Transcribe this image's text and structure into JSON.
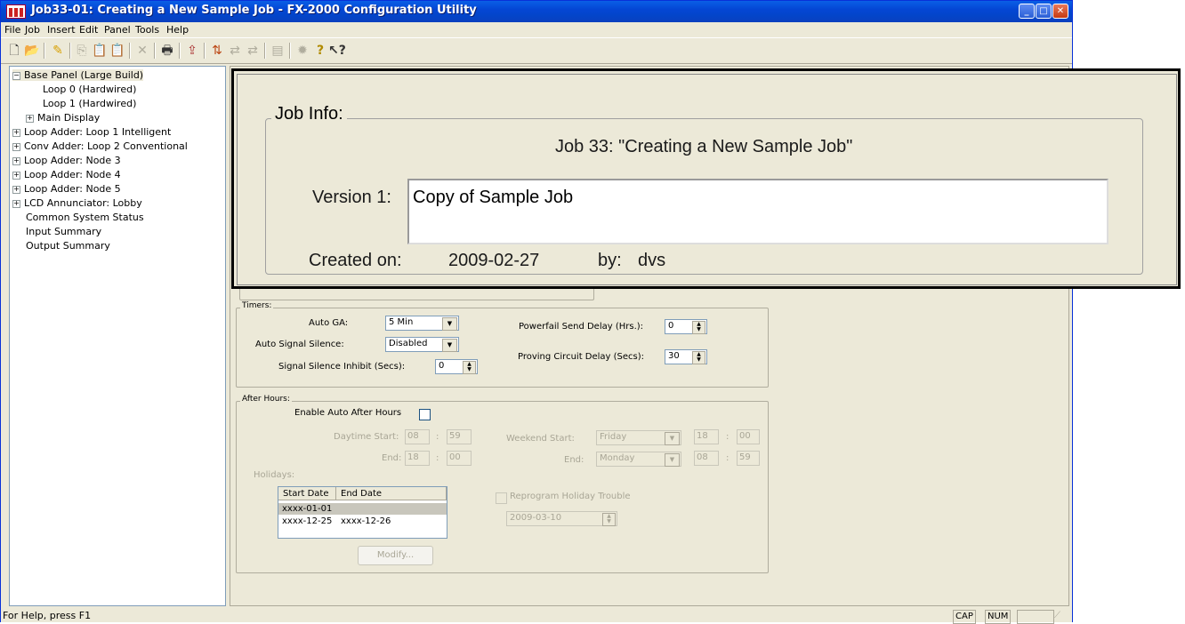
{
  "window": {
    "title": "Job33-01: Creating a New Sample Job - FX-2000 Configuration Utility"
  },
  "caption_buttons": {
    "minimize": "_",
    "maximize": "□",
    "close": "✕"
  },
  "menu": [
    "File",
    "Job",
    "Insert",
    "Edit",
    "Panel",
    "Tools",
    "Help"
  ],
  "toolbar_icons": [
    "new-icon",
    "open-icon",
    "edit-icon",
    "copy-icon",
    "paste-icon",
    "paste-special-icon",
    "delete-icon",
    "print-icon",
    "upload-icon",
    "download-icon",
    "compare-icon",
    "compare2-icon",
    "report-icon",
    "settings-icon",
    "help-icon",
    "context-help-icon"
  ],
  "tree": {
    "items": [
      {
        "label": "Base Panel (Large Build)",
        "exp": "−"
      },
      {
        "label": "Loop 0  (Hardwired)",
        "exp": ""
      },
      {
        "label": "Loop 1  (Hardwired)",
        "exp": ""
      },
      {
        "label": "Main Display",
        "exp": "+"
      },
      {
        "label": "Loop Adder: Loop 1 Intelligent",
        "exp": "+"
      },
      {
        "label": "Conv Adder: Loop 2 Conventional",
        "exp": "+"
      },
      {
        "label": "Loop Adder: Node 3",
        "exp": "+"
      },
      {
        "label": "Loop Adder: Node 4",
        "exp": "+"
      },
      {
        "label": "Loop Adder: Node 5",
        "exp": "+"
      },
      {
        "label": "LCD Annunciator: Lobby",
        "exp": "+"
      },
      {
        "label": "Common System Status",
        "exp": ""
      },
      {
        "label": "Input Summary",
        "exp": ""
      },
      {
        "label": "Output Summary",
        "exp": ""
      }
    ]
  },
  "job_info": {
    "legend": "Job Info:",
    "job_title": "Job 33:  \"Creating a New Sample Job\"",
    "version_label": "Version 1:",
    "version_text": "Copy of Sample Job",
    "created_label": "Created on:",
    "created_date": "2009-02-27",
    "by_label": "by:",
    "by_value": "dvs"
  },
  "timers": {
    "legend": "Timers:",
    "auto_ga_label": "Auto GA:",
    "auto_ga_value": "5 Min",
    "auto_signal_silence_label": "Auto Signal Silence:",
    "auto_signal_silence_value": "Disabled",
    "signal_silence_inhibit_label": "Signal Silence Inhibit (Secs):",
    "signal_silence_inhibit_value": "0",
    "powerfail_label": "Powerfail Send Delay (Hrs.):",
    "powerfail_value": "0",
    "proving_label": "Proving Circuit Delay (Secs):",
    "proving_value": "30"
  },
  "after_hours": {
    "legend": "After Hours:",
    "enable_label": "Enable Auto After Hours",
    "daytime_start_label": "Daytime Start:",
    "daytime_start_h": "08",
    "daytime_start_m": "59",
    "end_label": "End:",
    "end_h": "18",
    "end_m": "00",
    "weekend_start_label": "Weekend Start:",
    "weekend_start_day": "Friday",
    "weekend_start_h": "18",
    "weekend_start_m": "00",
    "weekend_end_label": "End:",
    "weekend_end_day": "Monday",
    "weekend_end_h": "08",
    "weekend_end_m": "59",
    "colon": ":",
    "holidays_label": "Holidays:",
    "holidays_columns": [
      "Start Date",
      "End Date"
    ],
    "holidays_rows": [
      [
        "xxxx-01-01",
        ""
      ],
      [
        "xxxx-12-25",
        "xxxx-12-26"
      ]
    ],
    "reprogram_label": "Reprogram Holiday Trouble",
    "reprogram_date": "2009-03-10",
    "modify_label": "Modify..."
  },
  "status": {
    "text": "For Help, press F1",
    "cap": "CAP",
    "num": "NUM"
  }
}
